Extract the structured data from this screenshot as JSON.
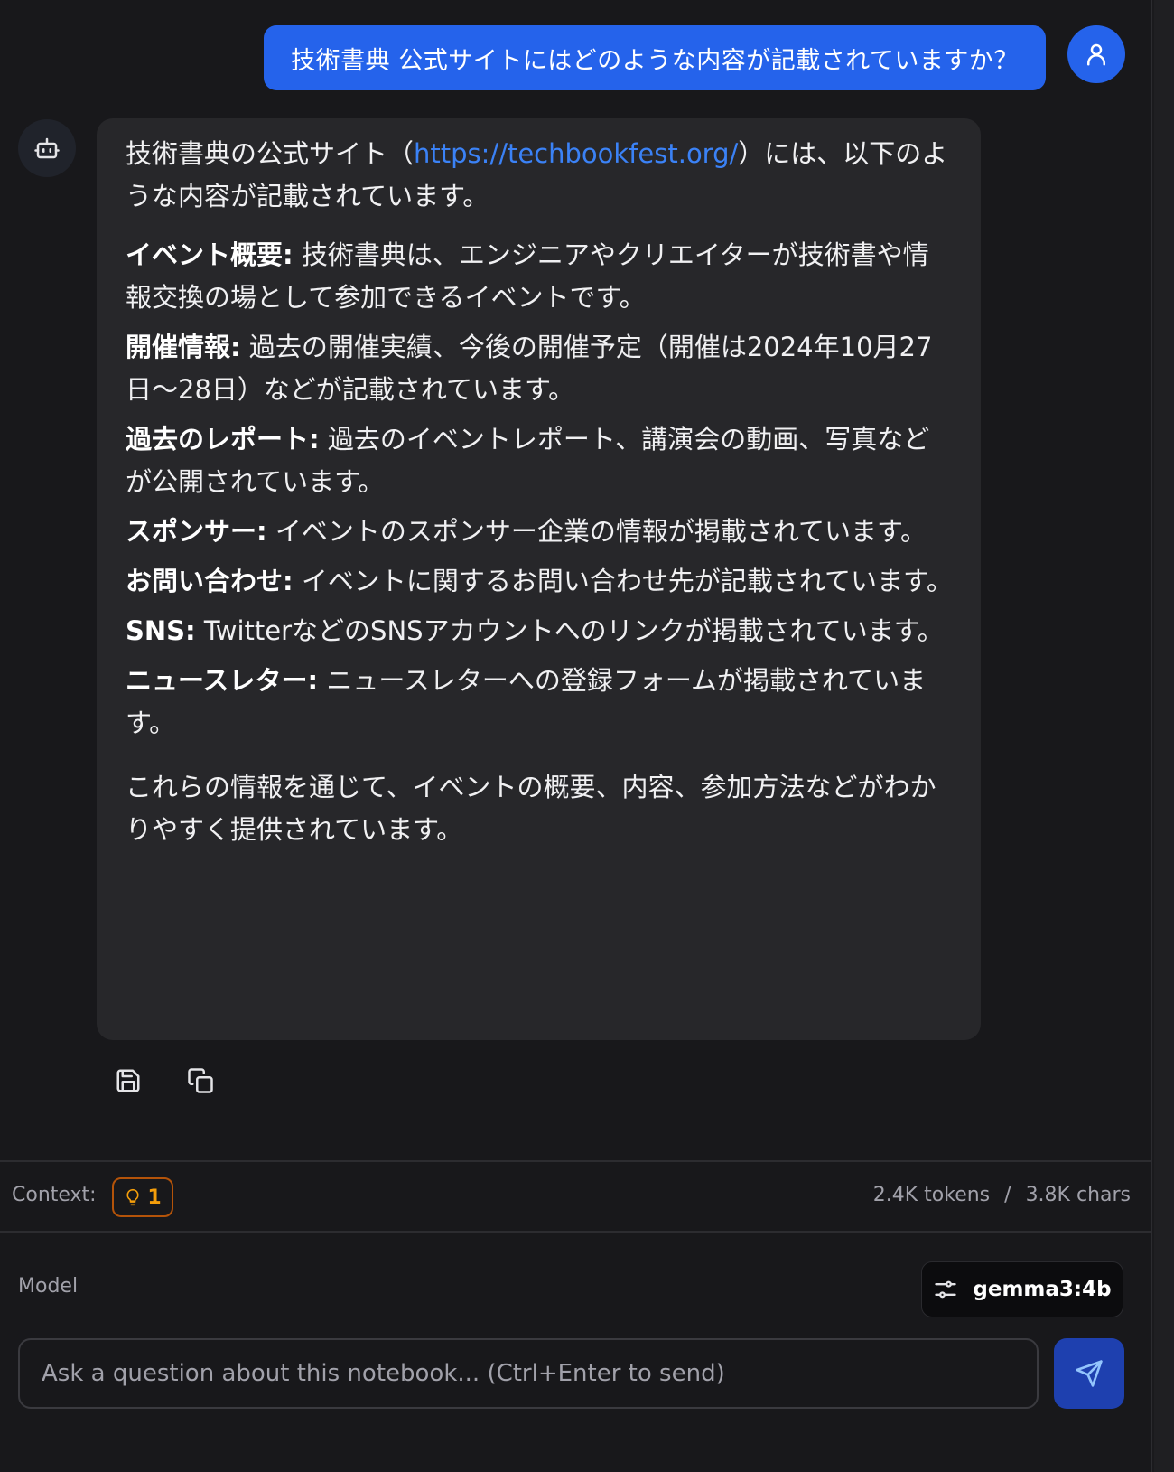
{
  "user_message": {
    "text": "技術書典 公式サイトにはどのような内容が記載されていますか？",
    "avatar_icon": "user-icon"
  },
  "bot_message": {
    "avatar_icon": "bot-icon",
    "intro_before_link": "技術書典の公式サイト（",
    "intro_link": "https://techbookfest.org/",
    "intro_after_link": "）には、以下のような内容が記載されています。",
    "items": [
      {
        "label": "イベント概要:",
        "text": " 技術書典は、エンジニアやクリエイターが技術書や情報交換の場として参加できるイベントです。"
      },
      {
        "label": "開催情報:",
        "text": " 過去の開催実績、今後の開催予定（開催は2024年10月27日～28日）などが記載されています。"
      },
      {
        "label": "過去のレポート:",
        "text": " 過去のイベントレポート、講演会の動画、写真などが公開されています。"
      },
      {
        "label": "スポンサー:",
        "text": " イベントのスポンサー企業の情報が掲載されています。"
      },
      {
        "label": "お問い合わせ:",
        "text": " イベントに関するお問い合わせ先が記載されています。"
      },
      {
        "label": "SNS:",
        "text": " TwitterなどのSNSアカウントへのリンクが掲載されています。"
      },
      {
        "label": "ニュースレター:",
        "text": " ニュースレターへの登録フォームが掲載されています。"
      }
    ],
    "outro": "これらの情報を通じて、イベントの概要、内容、参加方法などがわかりやすく提供されています。",
    "actions": [
      {
        "name": "save-icon"
      },
      {
        "name": "copy-icon"
      }
    ]
  },
  "context": {
    "label": "Context:",
    "badge_icon": "lightbulb-icon",
    "badge_count": "1",
    "tokens": "2.4K tokens",
    "separator": "/",
    "chars": "3.8K chars"
  },
  "model": {
    "label": "Model",
    "icon": "sliders-icon",
    "selected": "gemma3:4b"
  },
  "input": {
    "placeholder": "Ask a question about this notebook... (Ctrl+Enter to send)",
    "value": "",
    "send_icon": "send-icon"
  },
  "colors": {
    "accent": "#2563eb",
    "send_button": "#1e40af",
    "link": "#3b82f6",
    "badge": "#f59e0b",
    "bubble_bg": "#27272a",
    "panel_bg": "#18181b"
  }
}
